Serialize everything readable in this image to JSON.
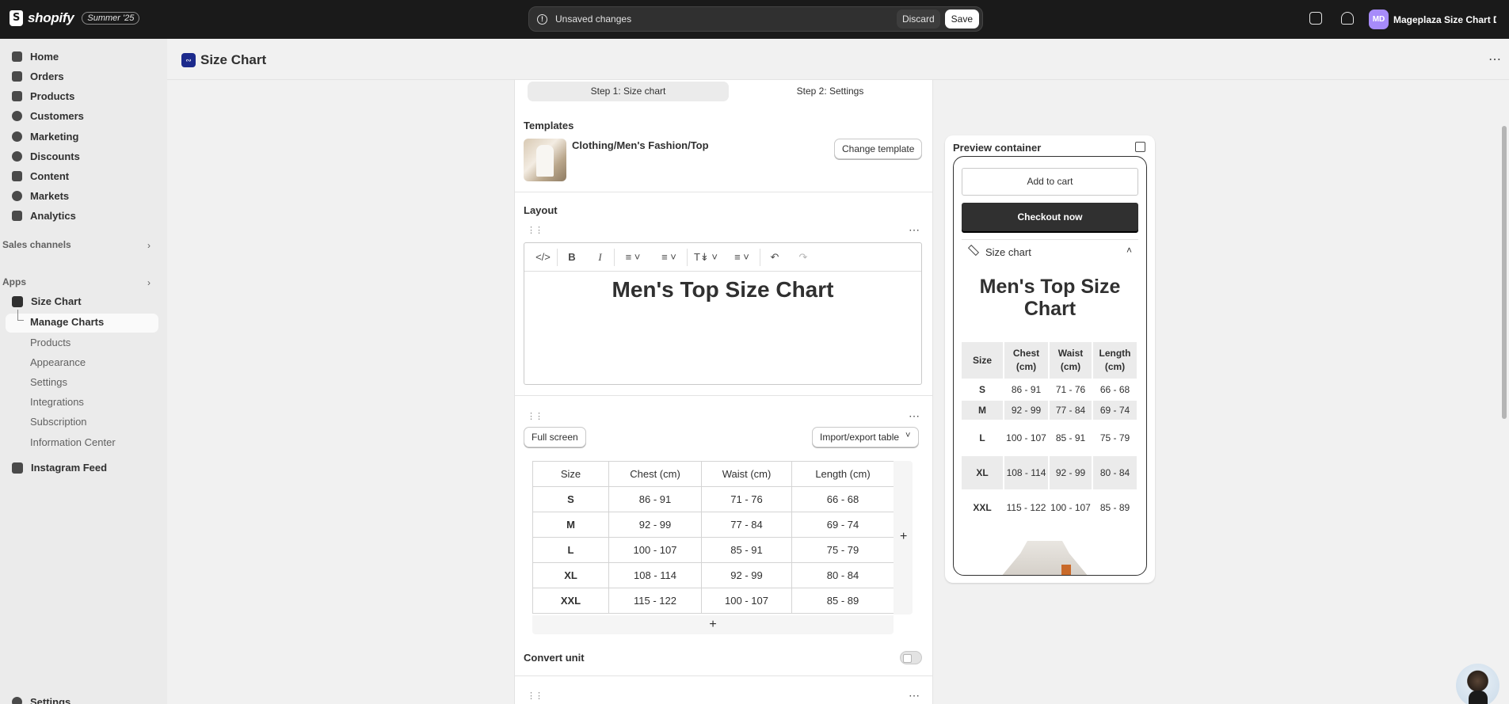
{
  "topbar": {
    "brand": "shopify",
    "badge": "Summer '25",
    "unsaved_text": "Unsaved changes",
    "discard_label": "Discard",
    "save_label": "Save",
    "store_initials": "MD",
    "store_name": "Mageplaza Size Chart De..."
  },
  "sidebar": {
    "items": [
      {
        "label": "Home",
        "icon": "home-icon"
      },
      {
        "label": "Orders",
        "icon": "inbox-icon"
      },
      {
        "label": "Products",
        "icon": "tag-icon"
      },
      {
        "label": "Customers",
        "icon": "person-icon"
      },
      {
        "label": "Marketing",
        "icon": "target-icon"
      },
      {
        "label": "Discounts",
        "icon": "discount-icon"
      },
      {
        "label": "Content",
        "icon": "content-icon"
      },
      {
        "label": "Markets",
        "icon": "globe-icon"
      },
      {
        "label": "Analytics",
        "icon": "bar-chart-icon"
      }
    ],
    "sales_channels_label": "Sales channels",
    "apps_label": "Apps",
    "app_name": "Size Chart",
    "app_subitems": [
      "Manage Charts",
      "Products",
      "Appearance",
      "Settings",
      "Integrations",
      "Subscription",
      "Information Center"
    ],
    "instagram_label": "Instagram Feed",
    "settings_label": "Settings"
  },
  "page": {
    "title": "Size Chart",
    "step1": "Step 1: Size chart",
    "step2": "Step 2: Settings",
    "templates_label": "Templates",
    "template_name": "Clothing/Men's Fashion/Top",
    "change_template_label": "Change template",
    "layout_label": "Layout",
    "editor_heading": "Men's Top Size Chart",
    "full_screen_label": "Full screen",
    "import_export_label": "Import/export table",
    "convert_unit_label": "Convert unit",
    "table": {
      "headers": [
        "Size",
        "Chest (cm)",
        "Waist (cm)",
        "Length (cm)"
      ],
      "rows": [
        [
          "S",
          "86 - 91",
          "71 - 76",
          "66 - 68"
        ],
        [
          "M",
          "92 - 99",
          "77 - 84",
          "69 - 74"
        ],
        [
          "L",
          "100 - 107",
          "85 - 91",
          "75 - 79"
        ],
        [
          "XL",
          "108 - 114",
          "92 - 99",
          "80 - 84"
        ],
        [
          "XXL",
          "115 - 122",
          "100 - 107",
          "85 - 89"
        ]
      ]
    },
    "add_symbol": "+"
  },
  "preview": {
    "title": "Preview container",
    "add_to_cart": "Add to cart",
    "checkout": "Checkout now",
    "size_chart_label": "Size chart",
    "heading": "Men's Top Size Chart",
    "headers": [
      "Size",
      "Chest (cm)",
      "Waist (cm)",
      "Length (cm)"
    ],
    "rows": [
      [
        "S",
        "86 - 91",
        "71 - 76",
        "66 - 68"
      ],
      [
        "M",
        "92 - 99",
        "77 - 84",
        "69 - 74"
      ],
      [
        "L",
        "100 - 107",
        "85 - 91",
        "75 - 79"
      ],
      [
        "XL",
        "108 - 114",
        "92 - 99",
        "80 - 84"
      ],
      [
        "XXL",
        "115 - 122",
        "100 - 107",
        "85 - 89"
      ]
    ]
  },
  "colors": {
    "topbar_bg": "#1a1a1a",
    "sidebar_bg": "#ebebeb",
    "page_bg": "#f1f1f1",
    "checkout_bg": "#303030",
    "app_icon": "#1c2a8c",
    "avatar_bg": "#a78bfa"
  }
}
